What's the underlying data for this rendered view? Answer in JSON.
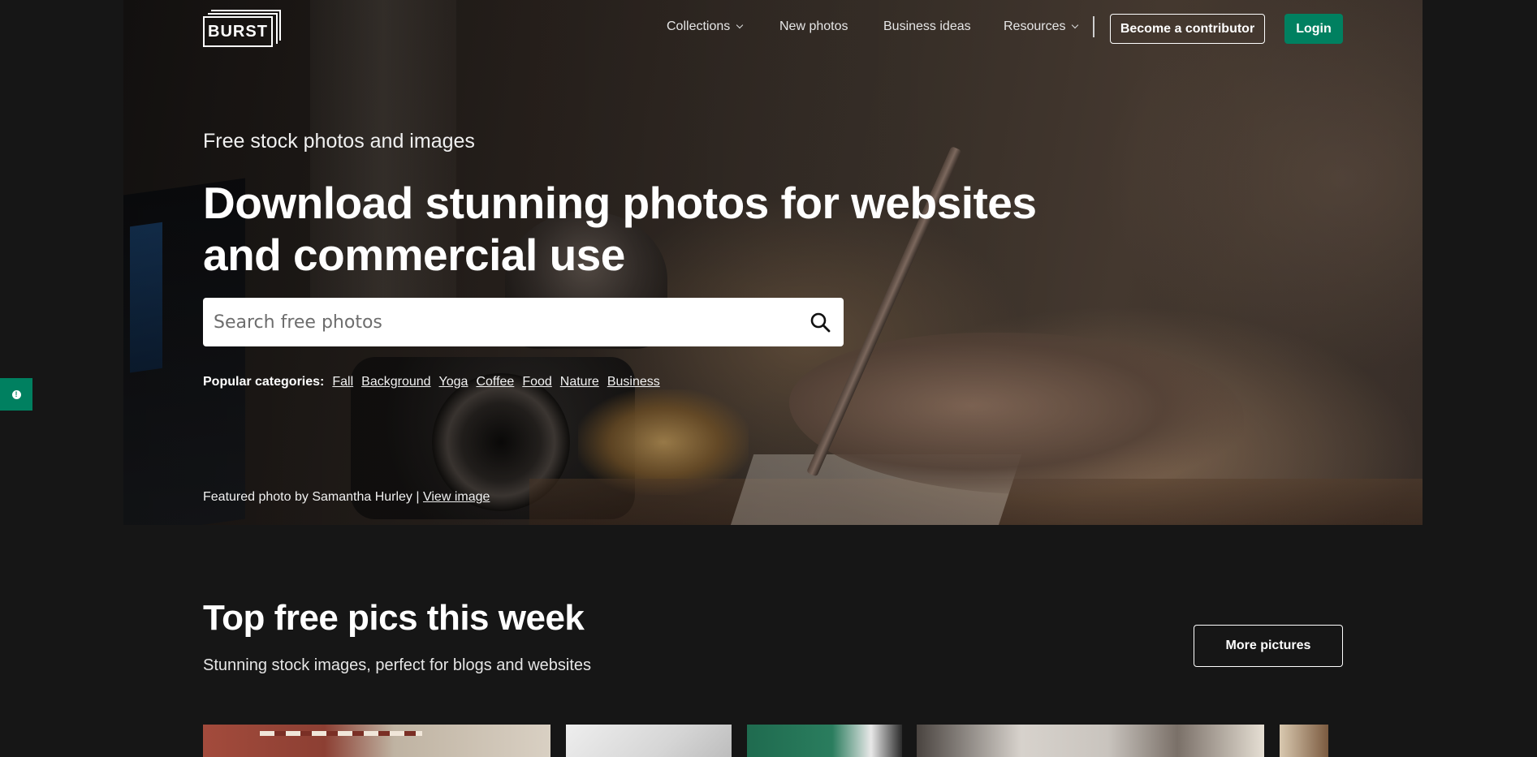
{
  "nav": {
    "logo_text": "BURST",
    "items": [
      {
        "label": "Collections",
        "has_dropdown": true
      },
      {
        "label": "New photos",
        "has_dropdown": false
      },
      {
        "label": "Business ideas",
        "has_dropdown": false
      },
      {
        "label": "Resources",
        "has_dropdown": true
      }
    ],
    "contributor_label": "Become a contributor",
    "login_label": "Login"
  },
  "hero": {
    "eyebrow": "Free stock photos and images",
    "headline": "Download stunning photos for websites and commercial use",
    "search_placeholder": "Search free photos",
    "categories_label": "Popular categories:",
    "categories": [
      "Fall",
      "Background",
      "Yoga",
      "Coffee",
      "Food",
      "Nature",
      "Business"
    ],
    "credit_text": "Featured photo by Samantha Hurley |",
    "credit_link": "View image"
  },
  "section": {
    "title": "Top free pics this week",
    "subtitle": "Stunning stock images, perfect for blogs and websites",
    "more_label": "More pictures"
  },
  "icons": {
    "search": "search-icon",
    "dropdown": "chevron-down-icon",
    "accessibility": "info-icon"
  },
  "colors": {
    "brand_green": "#008060",
    "page_bg": "#161616"
  }
}
